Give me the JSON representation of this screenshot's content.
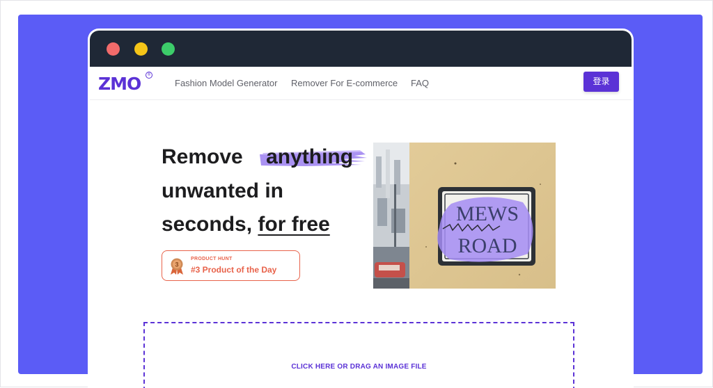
{
  "nav": {
    "logo": "ZMO",
    "logo_mark": "®",
    "links": [
      "Fashion Model Generator",
      "Remover For E-commerce",
      "FAQ"
    ],
    "login_label": "登录"
  },
  "hero": {
    "line1_a": "Remove",
    "line1_b": "anything",
    "line2": "unwanted in",
    "line3_a": "seconds, ",
    "line3_b": "for free"
  },
  "badge": {
    "small": "PRODUCT HUNT",
    "big": "#3 Product of the Day",
    "medal_number": "3"
  },
  "photo": {
    "sign_line1": "MEWS",
    "sign_line2": "ROAD"
  },
  "dropzone": {
    "label": "CLICK HERE OR DRAG AN IMAGE FILE"
  },
  "colors": {
    "stage": "#5b5cf6",
    "brand": "#5b32d6",
    "titlebar": "#1f2836",
    "badge": "#e8624a",
    "highlight": "#9b7ff0"
  }
}
